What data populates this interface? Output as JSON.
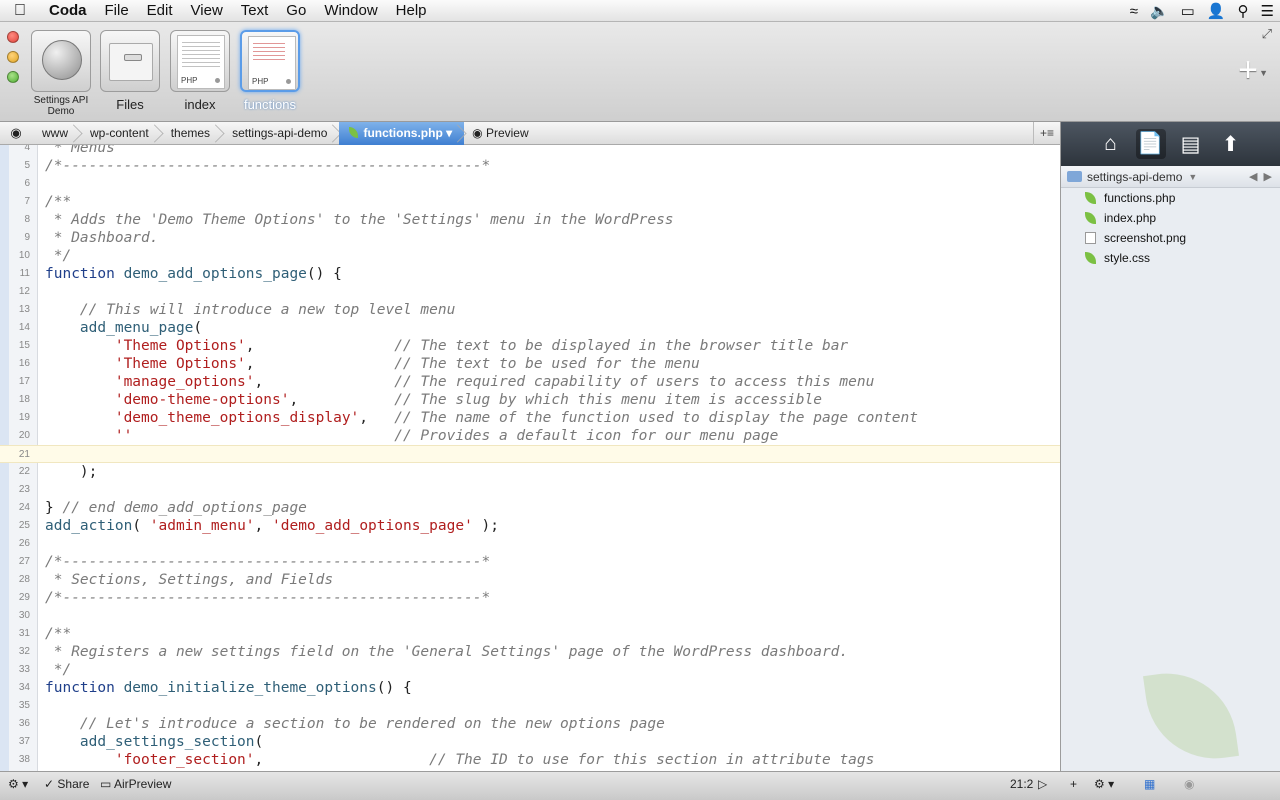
{
  "menubar": {
    "app": "Coda",
    "items": [
      "File",
      "Edit",
      "View",
      "Text",
      "Go",
      "Window",
      "Help"
    ]
  },
  "toolbar": {
    "sites": [
      {
        "label": "Settings API Demo",
        "kind": "site"
      },
      {
        "label": "Files",
        "kind": "files"
      },
      {
        "label": "index",
        "kind": "doc",
        "tag": "PHP"
      },
      {
        "label": "functions",
        "kind": "doc",
        "tag": "PHP",
        "active": true
      }
    ]
  },
  "pathbar": {
    "crumbs": [
      "www",
      "wp-content",
      "themes",
      "settings-api-demo"
    ],
    "active_file": "functions.php",
    "preview_label": "Preview"
  },
  "editor": {
    "current_line": 21,
    "lines": [
      {
        "n": 4,
        "tokens": [
          [
            "cm",
            " * Menus"
          ]
        ]
      },
      {
        "n": 5,
        "tokens": [
          [
            "cm",
            "/*------------------------------------------------*"
          ]
        ]
      },
      {
        "n": 6,
        "tokens": []
      },
      {
        "n": 7,
        "tokens": [
          [
            "cm",
            "/**"
          ]
        ]
      },
      {
        "n": 8,
        "tokens": [
          [
            "cm",
            " * Adds the 'Demo Theme Options' to the 'Settings' menu in the WordPress"
          ]
        ]
      },
      {
        "n": 9,
        "tokens": [
          [
            "cm",
            " * Dashboard."
          ]
        ]
      },
      {
        "n": 10,
        "tokens": [
          [
            "cm",
            " */"
          ]
        ]
      },
      {
        "n": 11,
        "tokens": [
          [
            "kw",
            "function "
          ],
          [
            "fn",
            "demo_add_options_page"
          ],
          [
            "pl",
            "() {"
          ]
        ]
      },
      {
        "n": 12,
        "tokens": []
      },
      {
        "n": 13,
        "tokens": [
          [
            "pl",
            "    "
          ],
          [
            "cm",
            "// This will introduce a new top level menu"
          ]
        ]
      },
      {
        "n": 14,
        "tokens": [
          [
            "pl",
            "    "
          ],
          [
            "fn",
            "add_menu_page"
          ],
          [
            "pl",
            "("
          ]
        ]
      },
      {
        "n": 15,
        "tokens": [
          [
            "pl",
            "        "
          ],
          [
            "st",
            "'Theme Options'"
          ],
          [
            "pl",
            ",                "
          ],
          [
            "cm",
            "// The text to be displayed in the browser title bar"
          ]
        ]
      },
      {
        "n": 16,
        "tokens": [
          [
            "pl",
            "        "
          ],
          [
            "st",
            "'Theme Options'"
          ],
          [
            "pl",
            ",                "
          ],
          [
            "cm",
            "// The text to be used for the menu"
          ]
        ]
      },
      {
        "n": 17,
        "tokens": [
          [
            "pl",
            "        "
          ],
          [
            "st",
            "'manage_options'"
          ],
          [
            "pl",
            ",               "
          ],
          [
            "cm",
            "// The required capability of users to access this menu"
          ]
        ]
      },
      {
        "n": 18,
        "tokens": [
          [
            "pl",
            "        "
          ],
          [
            "st",
            "'demo-theme-options'"
          ],
          [
            "pl",
            ",           "
          ],
          [
            "cm",
            "// The slug by which this menu item is accessible"
          ]
        ]
      },
      {
        "n": 19,
        "tokens": [
          [
            "pl",
            "        "
          ],
          [
            "st",
            "'demo_theme_options_display'"
          ],
          [
            "pl",
            ",   "
          ],
          [
            "cm",
            "// The name of the function used to display the page content"
          ]
        ]
      },
      {
        "n": 20,
        "tokens": [
          [
            "pl",
            "        "
          ],
          [
            "st",
            "''"
          ],
          [
            "pl",
            "                              "
          ],
          [
            "cm",
            "// Provides a default icon for our menu page"
          ]
        ]
      },
      {
        "n": 21,
        "tokens": []
      },
      {
        "n": 22,
        "tokens": [
          [
            "pl",
            "    );"
          ]
        ]
      },
      {
        "n": 23,
        "tokens": []
      },
      {
        "n": 24,
        "tokens": [
          [
            "pl",
            "} "
          ],
          [
            "cm",
            "// end demo_add_options_page"
          ]
        ]
      },
      {
        "n": 25,
        "tokens": [
          [
            "fn",
            "add_action"
          ],
          [
            "pl",
            "( "
          ],
          [
            "st",
            "'admin_menu'"
          ],
          [
            "pl",
            ", "
          ],
          [
            "st",
            "'demo_add_options_page'"
          ],
          [
            "pl",
            " );"
          ]
        ]
      },
      {
        "n": 26,
        "tokens": []
      },
      {
        "n": 27,
        "tokens": [
          [
            "cm",
            "/*------------------------------------------------*"
          ]
        ]
      },
      {
        "n": 28,
        "tokens": [
          [
            "cm",
            " * Sections, Settings, and Fields"
          ]
        ]
      },
      {
        "n": 29,
        "tokens": [
          [
            "cm",
            "/*------------------------------------------------*"
          ]
        ]
      },
      {
        "n": 30,
        "tokens": []
      },
      {
        "n": 31,
        "tokens": [
          [
            "cm",
            "/**"
          ]
        ]
      },
      {
        "n": 32,
        "tokens": [
          [
            "cm",
            " * Registers a new settings field on the 'General Settings' page of the WordPress dashboard."
          ]
        ]
      },
      {
        "n": 33,
        "tokens": [
          [
            "cm",
            " */"
          ]
        ]
      },
      {
        "n": 34,
        "tokens": [
          [
            "kw",
            "function "
          ],
          [
            "fn",
            "demo_initialize_theme_options"
          ],
          [
            "pl",
            "() {"
          ]
        ]
      },
      {
        "n": 35,
        "tokens": []
      },
      {
        "n": 36,
        "tokens": [
          [
            "pl",
            "    "
          ],
          [
            "cm",
            "// Let's introduce a section to be rendered on the new options page"
          ]
        ]
      },
      {
        "n": 37,
        "tokens": [
          [
            "pl",
            "    "
          ],
          [
            "fn",
            "add_settings_section"
          ],
          [
            "pl",
            "("
          ]
        ]
      },
      {
        "n": 38,
        "tokens": [
          [
            "pl",
            "        "
          ],
          [
            "st",
            "'footer_section'"
          ],
          [
            "pl",
            ",                   "
          ],
          [
            "cm",
            "// The ID to use for this section in attribute tags"
          ]
        ]
      }
    ]
  },
  "statusbar": {
    "share_label": "Share",
    "airpreview_label": "AirPreview",
    "cursor_position": "21:2"
  },
  "sidebar": {
    "folder": "settings-api-demo",
    "files": [
      {
        "name": "functions.php",
        "icon": "leaf"
      },
      {
        "name": "index.php",
        "icon": "leaf"
      },
      {
        "name": "screenshot.png",
        "icon": "img"
      },
      {
        "name": "style.css",
        "icon": "leaf"
      }
    ]
  }
}
